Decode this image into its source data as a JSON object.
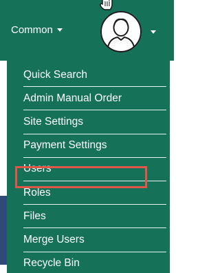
{
  "navbar": {
    "common_label": "Common",
    "user_avatar_icon": "user-avatar-icon",
    "caret_icon": "caret-down-icon",
    "cursor_icon": "hand-pointer-icon"
  },
  "dropdown": {
    "items": [
      {
        "label": "Quick Search"
      },
      {
        "label": "Admin Manual Order"
      },
      {
        "label": "Site Settings"
      },
      {
        "label": "Payment Settings"
      },
      {
        "label": "Users"
      },
      {
        "label": "Roles"
      },
      {
        "label": "Files"
      },
      {
        "label": "Merge Users"
      },
      {
        "label": "Recycle Bin"
      }
    ],
    "highlighted_item": "Site Settings"
  },
  "colors": {
    "brand_green": "#157158",
    "highlight_red": "#e0574a",
    "divider": "#e9f3ef"
  }
}
